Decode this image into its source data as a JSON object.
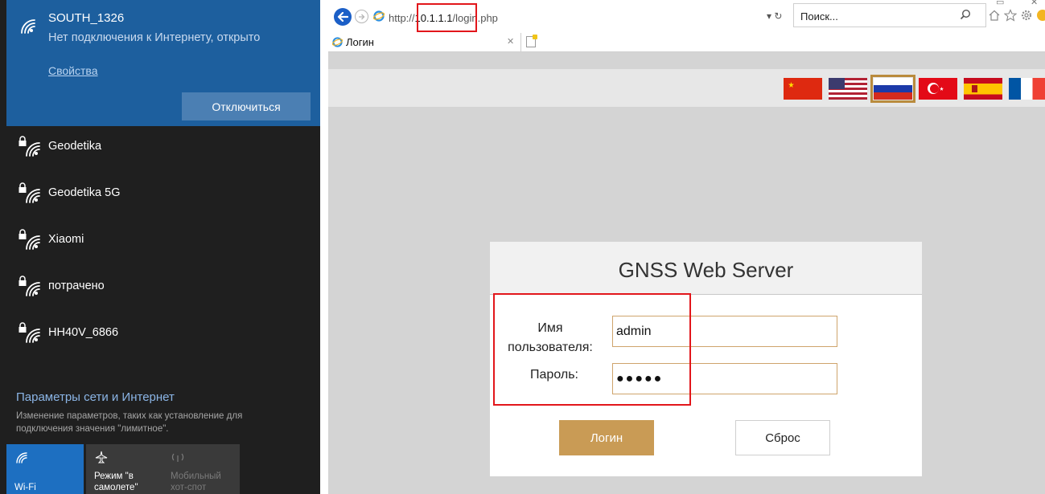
{
  "wifi_panel": {
    "connected": {
      "ssid": "SOUTH_1326",
      "status": "Нет подключения к Интернету, открыто",
      "properties_link": "Свойства",
      "disconnect_label": "Отключиться"
    },
    "networks": [
      {
        "name": "Geodetika",
        "locked": true
      },
      {
        "name": "Geodetika 5G",
        "locked": true
      },
      {
        "name": "Xiaomi",
        "locked": true
      },
      {
        "name": "потрачено",
        "locked": true
      },
      {
        "name": "HH40V_6866",
        "locked": true
      }
    ],
    "settings": {
      "title": "Параметры сети и Интернет",
      "description": "Изменение параметров, таких как установление для подключения значения \"лимитное\"."
    },
    "quick_actions": [
      {
        "label": "Wi-Fi",
        "icon": "wifi-icon",
        "state": "on"
      },
      {
        "label": "Режим \"в самолете\"",
        "icon": "airplane-icon",
        "state": "off"
      },
      {
        "label": "Мобильный хот-спот",
        "icon": "hotspot-icon",
        "state": "disabled"
      }
    ]
  },
  "browser": {
    "url_prefix": "http://",
    "url_host": "10.1.1.1",
    "url_path": "/login.php",
    "search_placeholder": "Поиск...",
    "tab_title": "Логин",
    "colors": {
      "back_button": "#1b5fc7",
      "highlight": "#e2161b"
    }
  },
  "page": {
    "languages": [
      {
        "code": "zh",
        "icon": "flag-china-icon",
        "selected": false
      },
      {
        "code": "en",
        "icon": "flag-usa-icon",
        "selected": false
      },
      {
        "code": "ru",
        "icon": "flag-russia-icon",
        "selected": true
      },
      {
        "code": "tr",
        "icon": "flag-turkey-icon",
        "selected": false
      },
      {
        "code": "es",
        "icon": "flag-spain-icon",
        "selected": false
      },
      {
        "code": "fr",
        "icon": "flag-france-icon",
        "selected": false
      }
    ],
    "login": {
      "title": "GNSS Web Server",
      "username_label_line1": "Имя",
      "username_label_line2": "пользователя:",
      "username_value": "admin",
      "password_label": "Пароль:",
      "password_value": "●●●●●",
      "login_button": "Логин",
      "reset_button": "Сброс",
      "colors": {
        "accent": "#c99b55"
      }
    }
  }
}
